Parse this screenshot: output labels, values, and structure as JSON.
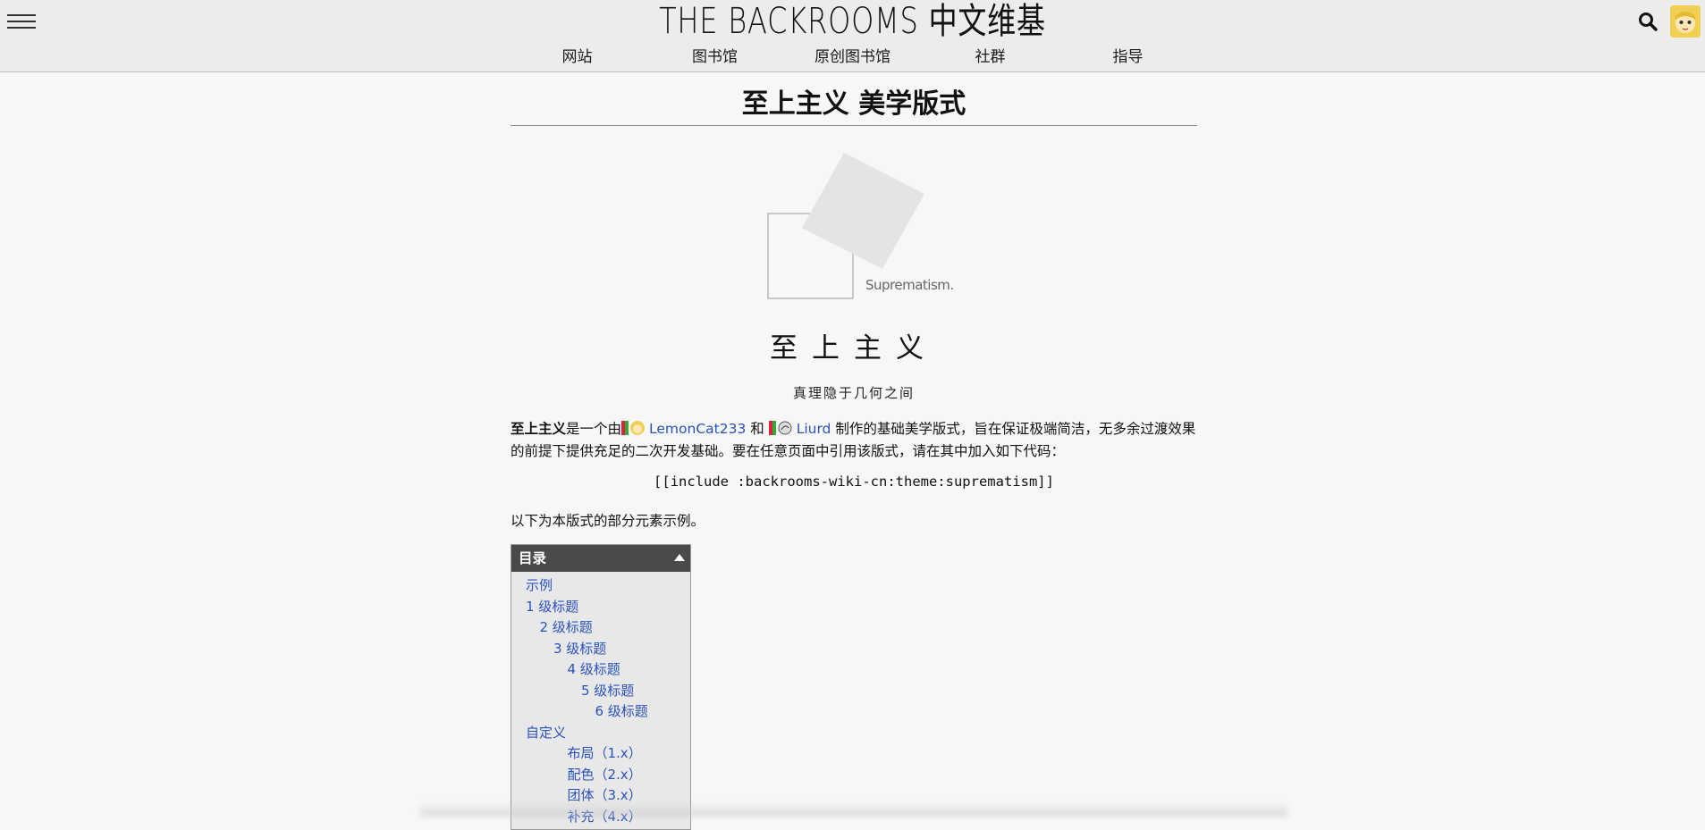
{
  "header": {
    "site_title": "THE BACKROOMS 中文维基",
    "nav": [
      "网站",
      "图书馆",
      "原创图书馆",
      "社群",
      "指导"
    ],
    "icons": {
      "menu": "hamburger-icon",
      "search": "search-icon",
      "avatar": "user-avatar"
    }
  },
  "page": {
    "title": "至上主义 美学版式",
    "logo_caption": "Suprematism.",
    "heading": "至上主义",
    "subheading": "真理隐于几何之间",
    "intro": {
      "bold": "至上主义",
      "t1": "是一个由",
      "user1": "LemonCat233",
      "t2": " 和 ",
      "user2": "Liurd",
      "t3": " 制作的基础美学版式，旨在保证极端简洁，无多余过渡效果的前提下提供充足的二次开发基础。要在任意页面中引用该版式，请在其中加入如下代码："
    },
    "code": "[[include :backrooms-wiki-cn:theme:suprematism]]",
    "para2": "以下为本版式的部分元素示例。"
  },
  "toc": {
    "title": "目录",
    "items": [
      {
        "label": "示例",
        "level": 0
      },
      {
        "label": "1 级标题",
        "level": 0
      },
      {
        "label": "2 级标题",
        "level": 1
      },
      {
        "label": "3 级标题",
        "level": 2
      },
      {
        "label": "4 级标题",
        "level": 3
      },
      {
        "label": "5 级标题",
        "level": 4
      },
      {
        "label": "6 级标题",
        "level": 5
      },
      {
        "label": "自定义",
        "level": 0
      },
      {
        "label": "布局（1.x）",
        "level": 3
      },
      {
        "label": "配色（2.x）",
        "level": 3
      },
      {
        "label": "团体（3.x）",
        "level": 3
      },
      {
        "label": "补充（4.x）",
        "level": 3
      }
    ]
  },
  "colors": {
    "link": "#2a52be",
    "toc_header": "#4a4a4a",
    "background": "#f7f7f7"
  }
}
